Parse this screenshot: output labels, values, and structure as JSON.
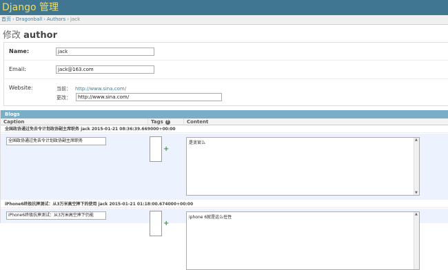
{
  "header": {
    "brand": "Django 管理"
  },
  "breadcrumbs": {
    "home": "首页",
    "app": "Dragonball",
    "model": "Authors",
    "current": "jack",
    "separator": "›"
  },
  "page": {
    "action": "修改",
    "model": "author"
  },
  "form": {
    "name": {
      "label": "Name:",
      "value": "jack"
    },
    "email": {
      "label": "Email:",
      "value": "jack@163.com"
    },
    "website": {
      "label": "Website:",
      "current_label": "当前：",
      "current_value": "http://www.sina.com/",
      "change_label": "更改：",
      "change_value": "http://www.sina.com/"
    }
  },
  "inline": {
    "title": "Blogs",
    "columns": {
      "caption": "Caption",
      "tags": "Tags",
      "help": "?",
      "content": "Content"
    },
    "rows": [
      {
        "original": "全国政协通过免去令计划政协副主席职务  jack 2015-01-21 08:36:39.669000+00:00",
        "caption": "全国政协通过免去令计划政协副主席职务",
        "content": "是贪官么"
      },
      {
        "original": "iPhone6终极抗摔测试：从3万米高空摔下的使用  jack 2015-01-21 01:18:00.674000+00:00",
        "caption": "iPhone6终极抗摔测试：从3万米高空摔下仍能",
        "content": "iphone 6就是这么任性"
      }
    ],
    "add_icon": "plus-icon"
  }
}
